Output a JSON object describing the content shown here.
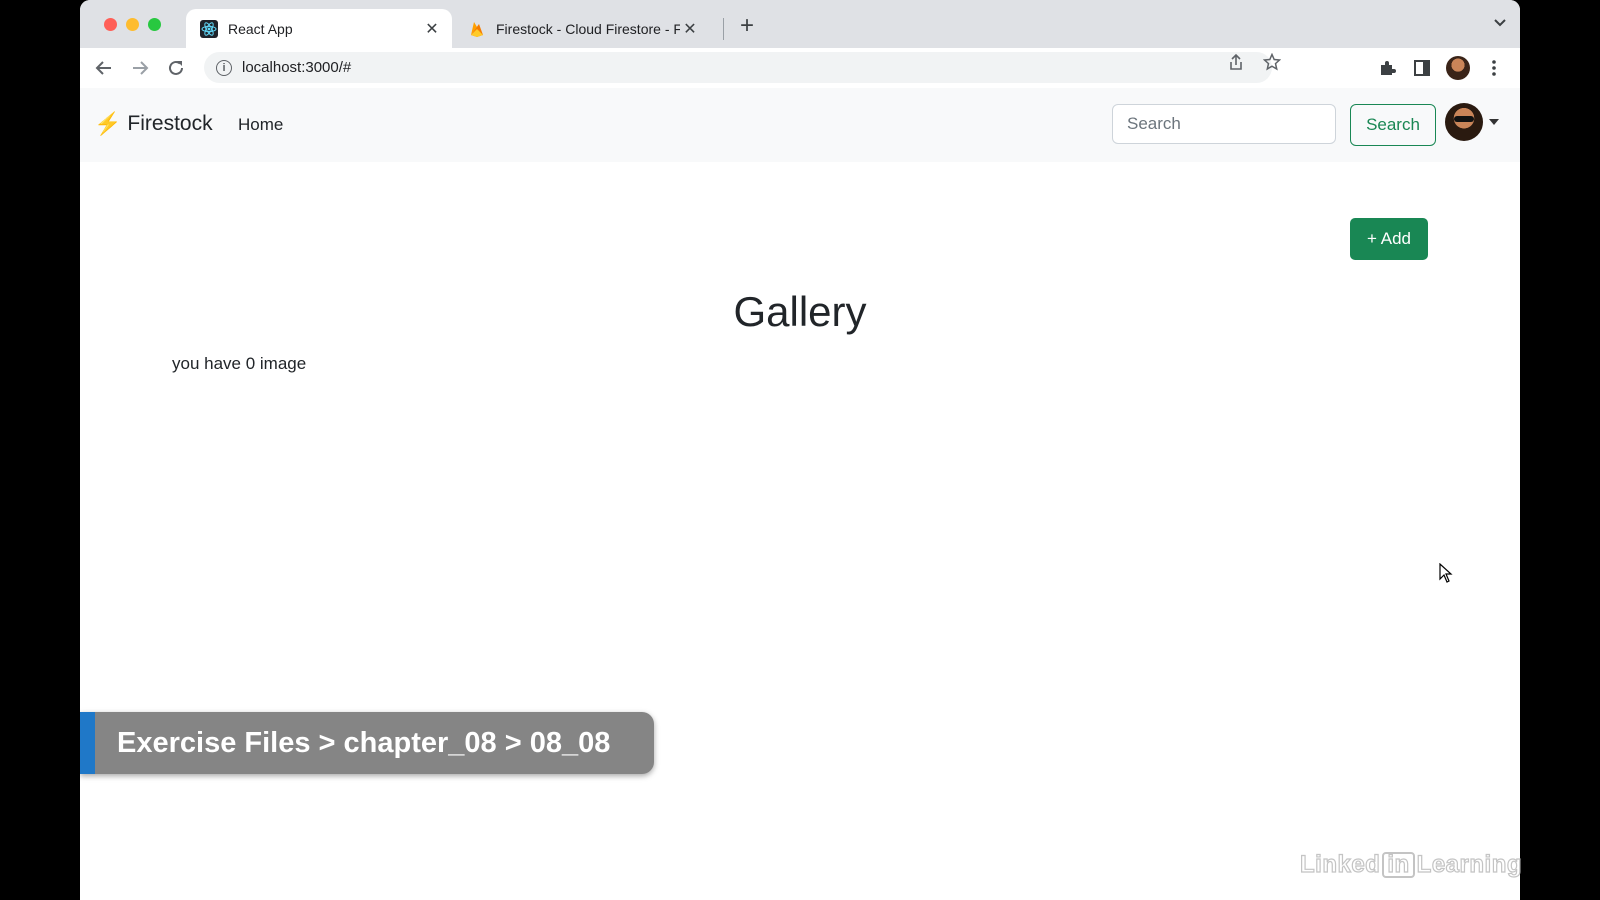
{
  "browser": {
    "tabs": [
      {
        "title": "React App",
        "active": true
      },
      {
        "title": "Firestock - Cloud Firestore - Fi",
        "active": false
      }
    ],
    "address": "localhost:3000/#",
    "close_glyph": "✕",
    "newtab_glyph": "+"
  },
  "app": {
    "brand": "Firestock",
    "nav": {
      "home": "Home"
    },
    "search": {
      "placeholder": "Search",
      "button": "Search"
    },
    "add_button": "+ Add",
    "page_title": "Gallery",
    "image_count_text": "you have 0 image"
  },
  "overlay": {
    "path": "Exercise Files > chapter_08 > 08_08",
    "watermark_left": "Linked",
    "watermark_in": "in",
    "watermark_right": "Learning"
  },
  "colors": {
    "success": "#198754",
    "brand_bolt": "#f2b705",
    "banner_stripe": "#1f78c8"
  },
  "icons": [
    "react-icon",
    "firebase-icon",
    "back-icon",
    "forward-icon",
    "reload-icon",
    "info-icon",
    "share-icon",
    "star-icon",
    "extensions-icon",
    "side-panel-icon",
    "more-icon",
    "bolt-icon",
    "chevron-down-icon"
  ]
}
